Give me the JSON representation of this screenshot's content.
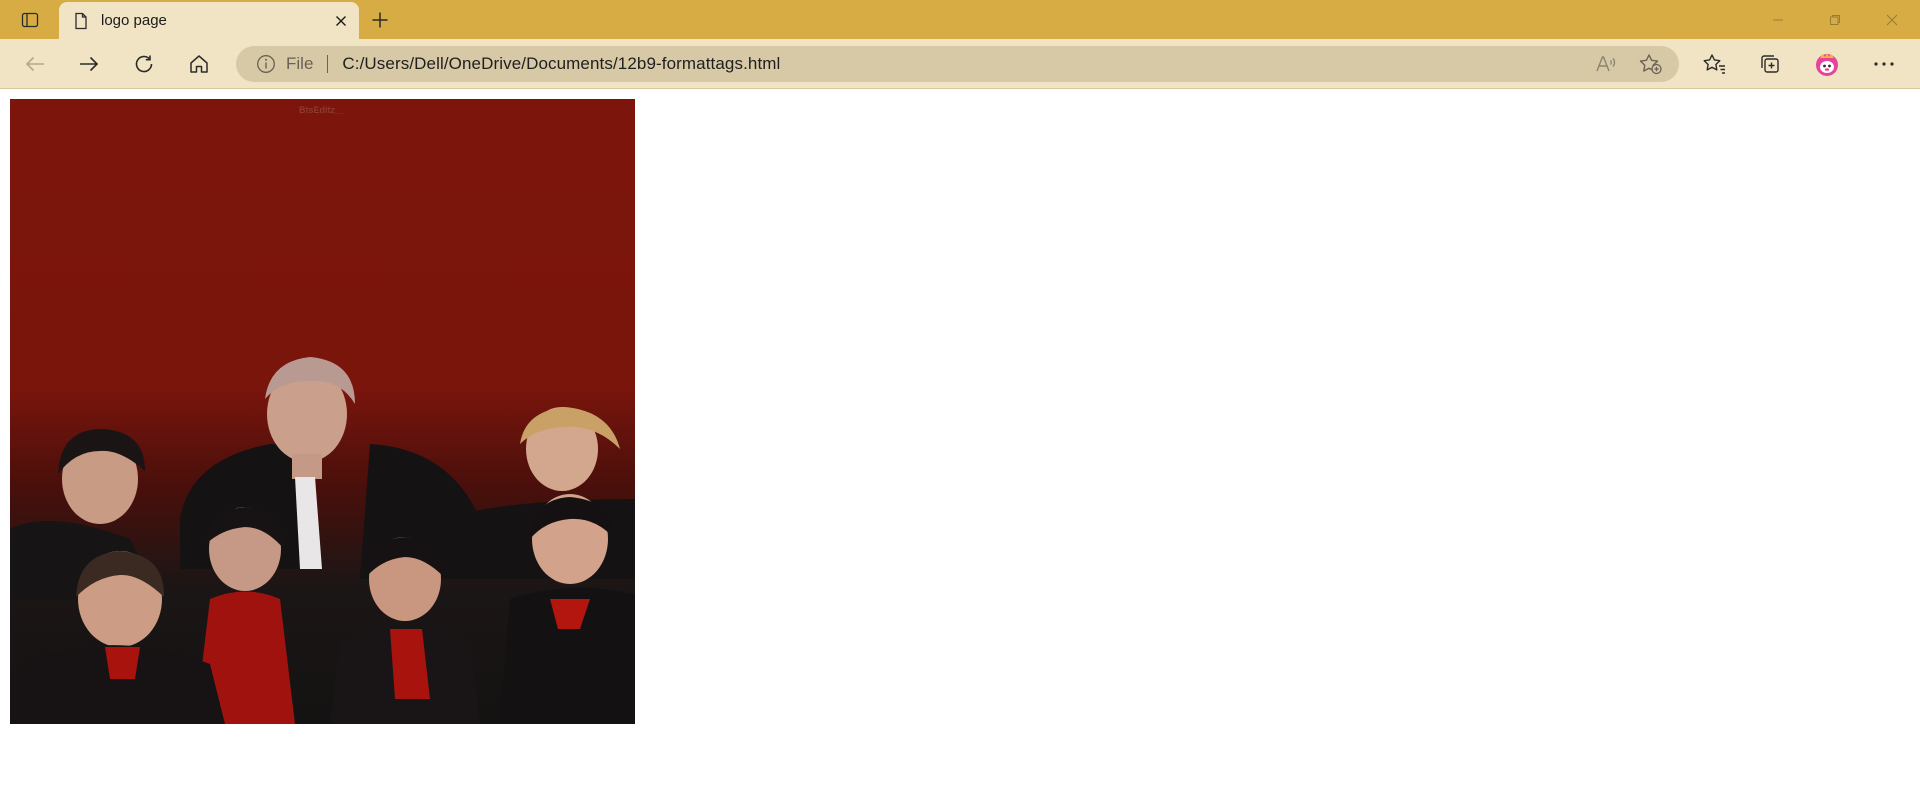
{
  "browser": {
    "tab": {
      "title": "logo page"
    },
    "address_bar": {
      "scheme": "File",
      "url": "C:/Users/Dell/OneDrive/Documents/12b9-formattags.html"
    },
    "theme": {
      "titlebar": "#d8ac44",
      "toolbar": "#f1e4c4",
      "address_field": "#d7c9a6"
    },
    "icons": {
      "tab_actions": "tab-actions-icon",
      "page": "page-icon",
      "close": "close-icon",
      "new_tab": "plus-icon",
      "back": "back-arrow-icon",
      "forward": "forward-arrow-icon",
      "refresh": "refresh-icon",
      "home": "home-icon",
      "info": "info-icon",
      "read_aloud": "read-aloud-icon",
      "add_favorite": "add-favorite-icon",
      "favorites": "favorites-icon",
      "collections": "collections-icon",
      "profile": "profile-avatar-icon",
      "menu": "more-icon"
    }
  },
  "page": {
    "image": {
      "description_name": "group-photo",
      "background": "#7a150c",
      "watermark": "BtsEditz__"
    }
  }
}
